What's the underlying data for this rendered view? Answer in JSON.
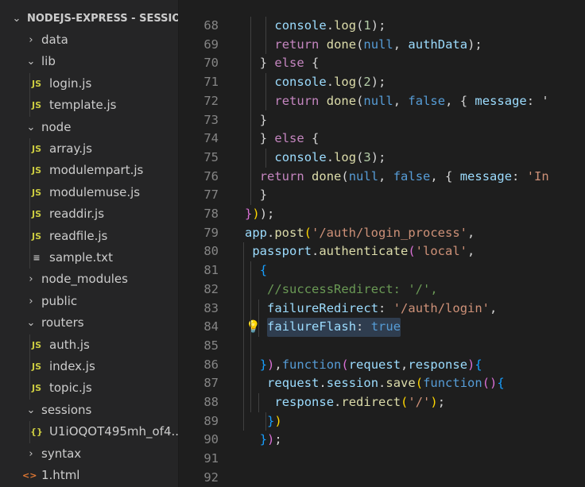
{
  "sidebar": {
    "project": "NODEJS-EXPRESS - SESSIO...",
    "items": [
      {
        "label": "data",
        "type": "folder",
        "open": false,
        "depth": 1
      },
      {
        "label": "lib",
        "type": "folder",
        "open": true,
        "depth": 1
      },
      {
        "label": "login.js",
        "type": "js",
        "depth": 2
      },
      {
        "label": "template.js",
        "type": "js",
        "depth": 2
      },
      {
        "label": "node",
        "type": "folder",
        "open": true,
        "depth": 1
      },
      {
        "label": "array.js",
        "type": "js",
        "depth": 2
      },
      {
        "label": "modulempart.js",
        "type": "js",
        "depth": 2
      },
      {
        "label": "modulemuse.js",
        "type": "js",
        "depth": 2
      },
      {
        "label": "readdir.js",
        "type": "js",
        "depth": 2
      },
      {
        "label": "readfile.js",
        "type": "js",
        "depth": 2
      },
      {
        "label": "sample.txt",
        "type": "txt",
        "depth": 2
      },
      {
        "label": "node_modules",
        "type": "folder",
        "open": false,
        "depth": 1
      },
      {
        "label": "public",
        "type": "folder",
        "open": false,
        "depth": 1
      },
      {
        "label": "routers",
        "type": "folder",
        "open": true,
        "depth": 1
      },
      {
        "label": "auth.js",
        "type": "js",
        "depth": 2
      },
      {
        "label": "index.js",
        "type": "js",
        "depth": 2
      },
      {
        "label": "topic.js",
        "type": "js",
        "depth": 2
      },
      {
        "label": "sessions",
        "type": "folder",
        "open": true,
        "depth": 1
      },
      {
        "label": "U1iOQOT495mh_of4...",
        "type": "json",
        "depth": 2
      },
      {
        "label": "syntax",
        "type": "folder",
        "open": false,
        "depth": 1
      },
      {
        "label": "1.html",
        "type": "html",
        "depth": 1
      }
    ]
  },
  "icons": {
    "js": "JS",
    "json": "{}",
    "html": "<>",
    "txt": "≡",
    "chevron_right": "›",
    "chevron_down": "⌄",
    "bulb": "💡"
  },
  "editor": {
    "lines": [
      {
        "n": "68",
        "indent": 2,
        "tokens": [
          [
            "v",
            "console"
          ],
          [
            "p",
            "."
          ],
          [
            "f",
            "log"
          ],
          [
            "p",
            "("
          ],
          [
            "n",
            "1"
          ],
          [
            "p",
            ");"
          ]
        ]
      },
      {
        "n": "69",
        "indent": 2,
        "tokens": [
          [
            "c",
            "return"
          ],
          [
            "p",
            " "
          ],
          [
            "f",
            "done"
          ],
          [
            "p",
            "("
          ],
          [
            "k",
            "null"
          ],
          [
            "p",
            ", "
          ],
          [
            "v",
            "authData"
          ],
          [
            "p",
            ");"
          ]
        ]
      },
      {
        "n": "70",
        "indent": 1,
        "tokens": [
          [
            "p",
            "} "
          ],
          [
            "c",
            "else"
          ],
          [
            "p",
            " {"
          ]
        ]
      },
      {
        "n": "71",
        "indent": 2,
        "tokens": [
          [
            "v",
            "console"
          ],
          [
            "p",
            "."
          ],
          [
            "f",
            "log"
          ],
          [
            "p",
            "("
          ],
          [
            "n",
            "2"
          ],
          [
            "p",
            ");"
          ]
        ]
      },
      {
        "n": "72",
        "indent": 2,
        "tokens": [
          [
            "c",
            "return"
          ],
          [
            "p",
            " "
          ],
          [
            "f",
            "done"
          ],
          [
            "p",
            "("
          ],
          [
            "k",
            "null"
          ],
          [
            "p",
            ", "
          ],
          [
            "k",
            "false"
          ],
          [
            "p",
            ", { "
          ],
          [
            "v",
            "message"
          ],
          [
            "p",
            ": '"
          ]
        ]
      },
      {
        "n": "73",
        "indent": 1,
        "tokens": [
          [
            "p",
            "}"
          ]
        ]
      },
      {
        "n": "74",
        "indent": 1,
        "tokens": [
          [
            "p",
            "} "
          ],
          [
            "c",
            "else"
          ],
          [
            "p",
            " {"
          ]
        ]
      },
      {
        "n": "75",
        "indent": 2,
        "tokens": [
          [
            "v",
            "console"
          ],
          [
            "p",
            "."
          ],
          [
            "f",
            "log"
          ],
          [
            "p",
            "("
          ],
          [
            "n",
            "3"
          ],
          [
            "p",
            ");"
          ]
        ]
      },
      {
        "n": "76",
        "indent": 1,
        "tokens": [
          [
            "c",
            "return"
          ],
          [
            "p",
            " "
          ],
          [
            "f",
            "done"
          ],
          [
            "p",
            "("
          ],
          [
            "k",
            "null"
          ],
          [
            "p",
            ", "
          ],
          [
            "k",
            "false"
          ],
          [
            "p",
            ", { "
          ],
          [
            "v",
            "message"
          ],
          [
            "p",
            ": "
          ],
          [
            "s",
            "'In"
          ]
        ]
      },
      {
        "n": "77",
        "indent": 1,
        "tokens": [
          [
            "p",
            "}"
          ]
        ]
      },
      {
        "n": "78",
        "indent": 0,
        "tokens": [
          [
            "br2",
            "}"
          ],
          [
            "br1",
            ")"
          ],
          [
            "p",
            ");"
          ]
        ]
      },
      {
        "n": "79",
        "indent": 0,
        "tokens": [
          [
            "v",
            "app"
          ],
          [
            "p",
            "."
          ],
          [
            "f",
            "post"
          ],
          [
            "br1",
            "("
          ],
          [
            "s",
            "'/auth/login_process'"
          ],
          [
            "p",
            ","
          ]
        ]
      },
      {
        "n": "80",
        "indent": 0.5,
        "tokens": [
          [
            "v",
            "passport"
          ],
          [
            "p",
            "."
          ],
          [
            "f",
            "authenticate"
          ],
          [
            "br2",
            "("
          ],
          [
            "s",
            "'local'"
          ],
          [
            "p",
            ","
          ]
        ]
      },
      {
        "n": "81",
        "indent": 1,
        "tokens": [
          [
            "br3",
            "{"
          ]
        ]
      },
      {
        "n": "82",
        "indent": 1.5,
        "tokens": [
          [
            "cm",
            "//successRedirect: '/',"
          ]
        ]
      },
      {
        "n": "83",
        "indent": 1.5,
        "tokens": [
          [
            "v",
            "failureRedirect"
          ],
          [
            "p",
            ": "
          ],
          [
            "s",
            "'/auth/login'"
          ],
          [
            "p",
            ","
          ]
        ]
      },
      {
        "n": "84",
        "indent": 1.5,
        "highlight": true,
        "bulb": true,
        "tokens": [
          [
            "v",
            "failureFlash"
          ],
          [
            "p",
            ": "
          ],
          [
            "k",
            "true"
          ]
        ]
      },
      {
        "n": "85",
        "indent": 0,
        "tokens": []
      },
      {
        "n": "86",
        "indent": 1,
        "tokens": [
          [
            "br3",
            "}"
          ],
          [
            "br2",
            ")"
          ],
          [
            "p",
            ","
          ],
          [
            "k",
            "function"
          ],
          [
            "br2",
            "("
          ],
          [
            "v",
            "request"
          ],
          [
            "p",
            ","
          ],
          [
            "v",
            "response"
          ],
          [
            "br2",
            ")"
          ],
          [
            "br3",
            "{"
          ]
        ]
      },
      {
        "n": "87",
        "indent": 1.5,
        "tokens": [
          [
            "v",
            "request"
          ],
          [
            "p",
            "."
          ],
          [
            "v",
            "session"
          ],
          [
            "p",
            "."
          ],
          [
            "f",
            "save"
          ],
          [
            "br1",
            "("
          ],
          [
            "k",
            "function"
          ],
          [
            "br2",
            "()"
          ],
          [
            "br3",
            "{"
          ]
        ]
      },
      {
        "n": "88",
        "indent": 2,
        "tokens": [
          [
            "v",
            "response"
          ],
          [
            "p",
            "."
          ],
          [
            "f",
            "redirect"
          ],
          [
            "br1",
            "("
          ],
          [
            "s",
            "'/'"
          ],
          [
            "br1",
            ")"
          ],
          [
            "p",
            ";"
          ]
        ]
      },
      {
        "n": "89",
        "indent": 1.5,
        "tokens": [
          [
            "br3",
            "}"
          ],
          [
            "br1",
            ")"
          ]
        ]
      },
      {
        "n": "90",
        "indent": 1,
        "tokens": [
          [
            "br3",
            "}"
          ],
          [
            "br2",
            ")"
          ],
          [
            "p",
            ";"
          ]
        ]
      },
      {
        "n": "91",
        "indent": 0,
        "tokens": []
      },
      {
        "n": "92",
        "indent": 0,
        "tokens": []
      }
    ]
  }
}
